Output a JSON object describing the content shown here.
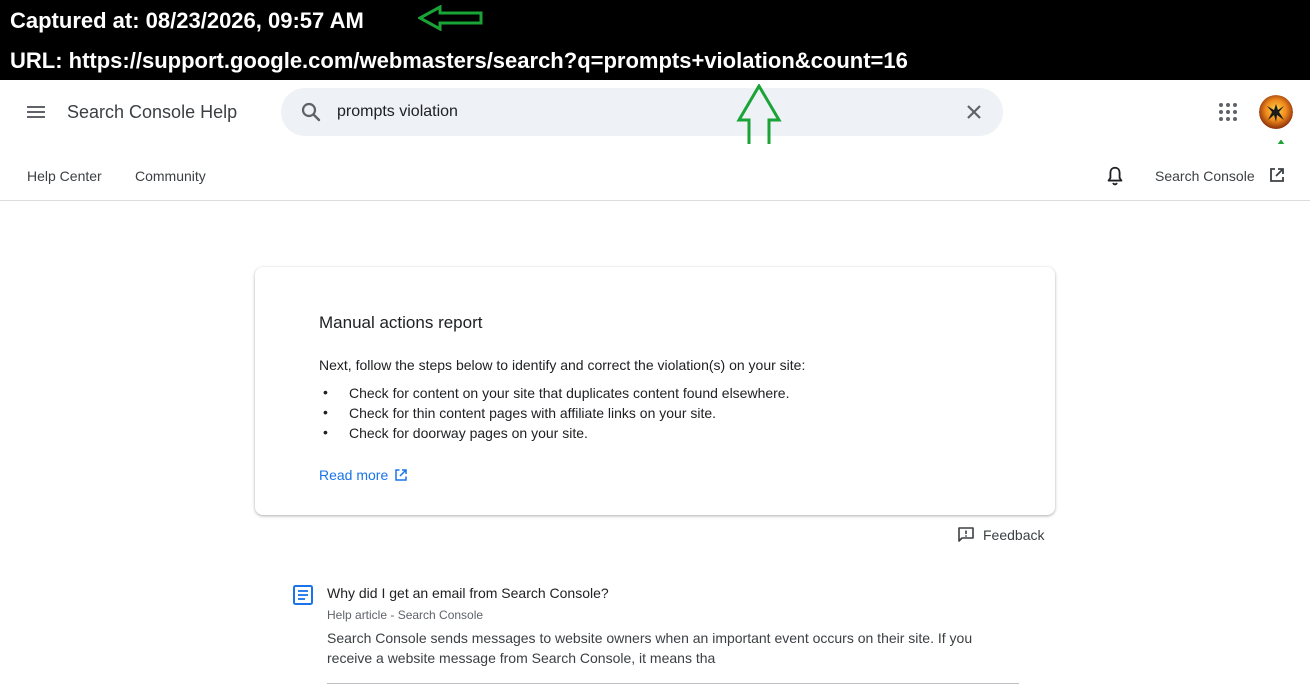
{
  "capture": {
    "captured_at": "Captured at: 08/23/2026, 09:57 AM",
    "url": "URL: https://support.google.com/webmasters/search?q=prompts+violation&count=16"
  },
  "header": {
    "title": "Search Console Help",
    "search_value": "prompts violation"
  },
  "subnav": {
    "help_center": "Help Center",
    "community": "Community",
    "search_console": "Search Console"
  },
  "card": {
    "title": "Manual actions report",
    "lead": "Next, follow the steps below to identify and correct the violation(s) on your site:",
    "items": [
      "Check for content on your site that duplicates content found elsewhere.",
      "Check for thin content pages with affiliate links on your site.",
      "Check for doorway pages on your site."
    ],
    "read_more": "Read more"
  },
  "feedback_label": "Feedback",
  "results": [
    {
      "title": "Why did I get an email from Search Console?",
      "meta": "Help article - Search Console",
      "snippet": "Search Console sends messages to website owners when an important event occurs on their site. If you receive a website message from Search Console, it means tha"
    }
  ],
  "colors": {
    "accent": "#1a73e8",
    "annotation_arrow": "#1aa336"
  },
  "icons": [
    "menu-icon",
    "search-icon",
    "close-icon",
    "apps-icon",
    "bell-icon",
    "external-link-icon",
    "feedback-icon",
    "document-icon",
    "arrow-left-icon",
    "arrow-up-icon"
  ]
}
